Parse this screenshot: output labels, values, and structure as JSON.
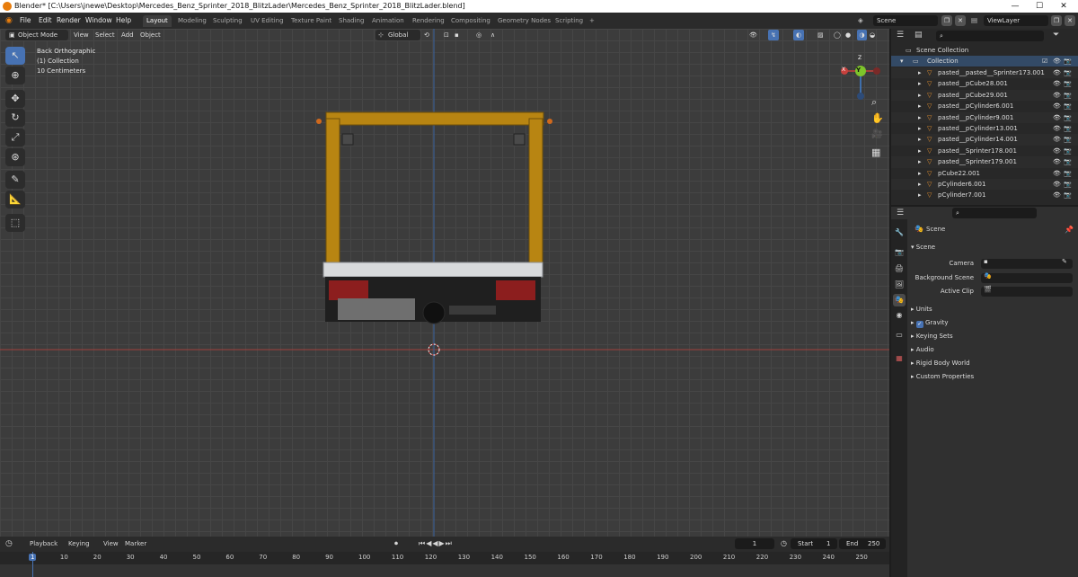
{
  "title_bar": {
    "title": "Blender* [C:\\Users\\jnewe\\Desktop\\Mercedes_Benz_Sprinter_2018_BlitzLader\\Mercedes_Benz_Sprinter_2018_BlitzLader.blend]",
    "minimize": "—",
    "maximize": "☐",
    "close": "✕"
  },
  "menu": [
    "File",
    "Edit",
    "Render",
    "Window",
    "Help"
  ],
  "workspaces": [
    "Layout",
    "Modeling",
    "Sculpting",
    "UV Editing",
    "Texture Paint",
    "Shading",
    "Animation",
    "Rendering",
    "Compositing",
    "Geometry Nodes",
    "Scripting",
    "+"
  ],
  "active_workspace": "Layout",
  "scene_field": "Scene",
  "view_layer_field": "ViewLayer",
  "viewport_header": {
    "mode": "Object Mode",
    "menus": [
      "View",
      "Select",
      "Add",
      "Object"
    ],
    "transform_orientation": "Global"
  },
  "viewport_overlay": {
    "view_name": "Back Orthographic",
    "collection": "(1) Collection",
    "scale": "10 Centimeters"
  },
  "gizmo": {
    "x": "X",
    "y": "Y",
    "z": "Z"
  },
  "outliner": {
    "root": "Scene Collection",
    "collection": "Collection",
    "items": [
      "pasted__pasted__Sprinter173.001",
      "pasted__pCube28.001",
      "pasted__pCube29.001",
      "pasted__pCylinder6.001",
      "pasted__pCylinder9.001",
      "pasted__pCylinder13.001",
      "pasted__pCylinder14.001",
      "pasted__Sprinter178.001",
      "pasted__Sprinter179.001",
      "pCube22.001",
      "pCylinder6.001",
      "pCylinder7.001"
    ]
  },
  "properties": {
    "context": "Scene",
    "panel_title": "Scene",
    "fields": [
      {
        "label": "Camera"
      },
      {
        "label": "Background Scene"
      },
      {
        "label": "Active Clip"
      }
    ],
    "subpanels": [
      "Units",
      "Gravity",
      "Keying Sets",
      "Audio",
      "Rigid Body World",
      "Custom Properties"
    ],
    "gravity_checked": true
  },
  "timeline": {
    "menus": [
      "Playback",
      "Keying",
      "View",
      "Marker"
    ],
    "current_frame": "1",
    "start_label": "Start",
    "start_value": "1",
    "end_label": "End",
    "end_value": "250",
    "ruler": [
      "1",
      "10",
      "20",
      "30",
      "40",
      "50",
      "60",
      "70",
      "80",
      "90",
      "100",
      "110",
      "120",
      "130",
      "140",
      "150",
      "160",
      "170",
      "180",
      "190",
      "200",
      "210",
      "220",
      "230",
      "240",
      "250"
    ]
  },
  "colors": {
    "accent": "#4772b3",
    "frame_bar": "#c08a16",
    "x_axis": "#c8413d",
    "y_axis": "#7ec42b",
    "z_axis": "#3f7fd0"
  }
}
